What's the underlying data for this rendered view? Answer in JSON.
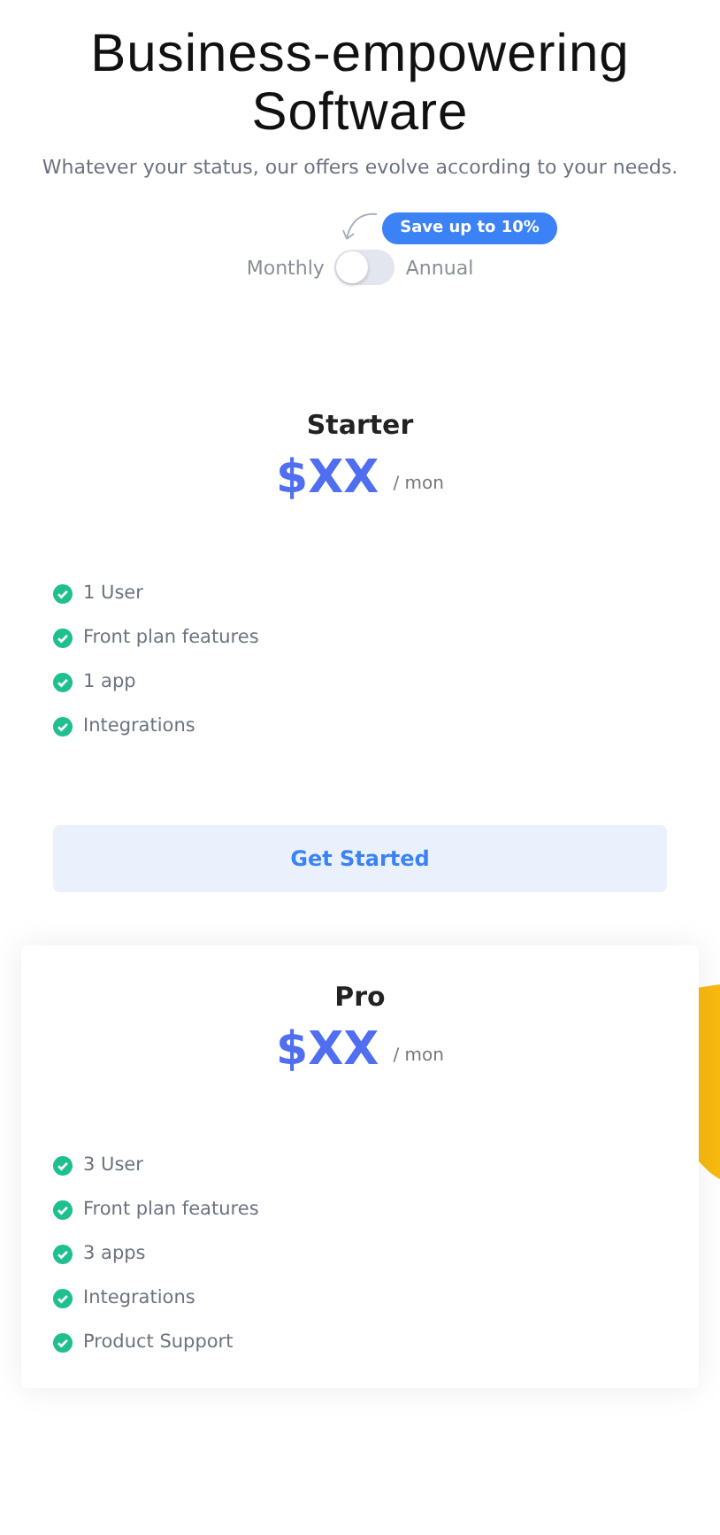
{
  "header": {
    "title_lines": [
      "Business-empowering",
      "Software"
    ],
    "subtitle": "Whatever your status, our offers evolve according to your needs."
  },
  "billing": {
    "badge": "Save up to 10%",
    "left_label": "Monthly",
    "right_label": "Annual",
    "on": false
  },
  "plans": [
    {
      "name": "Starter",
      "price": "$XX",
      "period": "/ mon",
      "highlighted": false,
      "features": [
        "1 User",
        "Front plan features",
        "1 app",
        "Integrations"
      ],
      "button": "Get Started"
    },
    {
      "name": "Pro",
      "price": "$XX",
      "period": "/ mon",
      "highlighted": true,
      "features": [
        "3 User",
        "Front plan features",
        "3 apps",
        "Integrations",
        "Product Support"
      ]
    }
  ]
}
